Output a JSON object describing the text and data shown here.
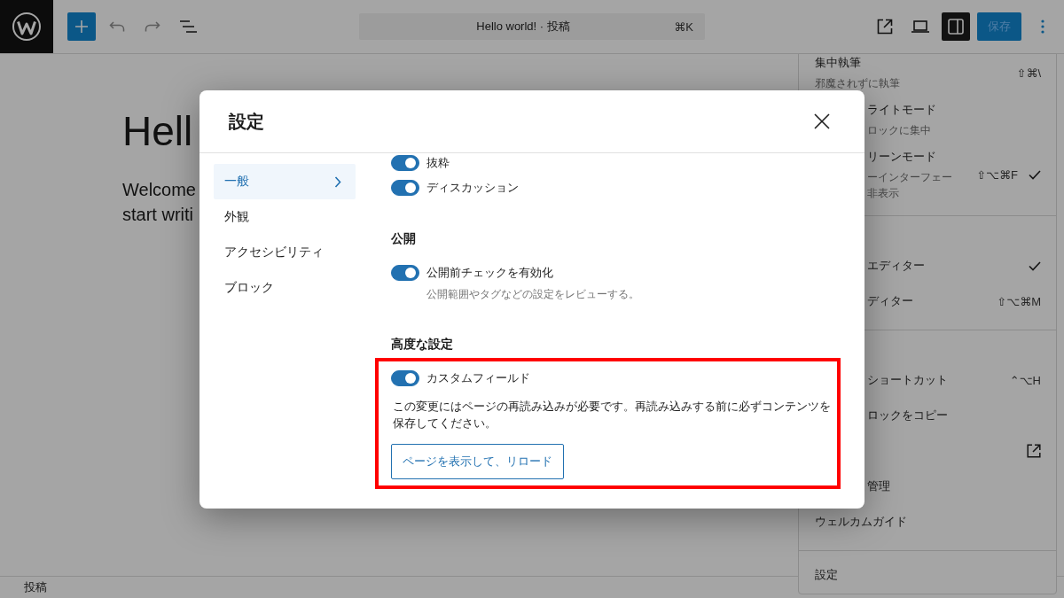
{
  "top_bar": {
    "command_center": {
      "title": "Hello world! · 投稿",
      "shortcut": "⌘K"
    },
    "sidebar_toggle": {
      "pressed": true
    },
    "save_button": {
      "label": "保存",
      "disabled": true
    },
    "menu_button": {
      "pressed": true
    }
  },
  "editor": {
    "title": "Hell",
    "body_lines": [
      "Welcome",
      "start writi"
    ]
  },
  "options_menu": {
    "groups": [
      {
        "items": [
          {
            "label": "集中執筆",
            "description_lines": [
              "邪魔されずに執筆"
            ],
            "shortcut": "⇧⌘\\",
            "checked": false
          },
          {
            "label": "ライトモード",
            "description_lines": [
              "ロックに集中"
            ],
            "checked": false
          },
          {
            "label": "リーンモード",
            "description_lines": [
              "ーインターフェー",
              "非表示"
            ],
            "shortcut": "⇧⌥⌘F",
            "checked": true
          }
        ]
      },
      {
        "items": [
          {
            "label": "エディター",
            "checked": true
          },
          {
            "label": "ディター",
            "shortcut": "⇧⌥⌘M",
            "checked": false
          }
        ]
      },
      {
        "items": [
          {
            "label": "ショートカット",
            "shortcut": "⌃⌥H"
          },
          {
            "label": "ロックをコピー"
          },
          {
            "external": true
          },
          {
            "label": "管理"
          },
          {
            "label": "ウェルカムガイド"
          }
        ]
      },
      {
        "items": [
          {
            "label": "設定"
          }
        ]
      }
    ]
  },
  "settings_modal": {
    "title": "設定",
    "nav": [
      {
        "label": "一般",
        "selected": true
      },
      {
        "label": "外観",
        "selected": false
      },
      {
        "label": "アクセシビリティ",
        "selected": false
      },
      {
        "label": "ブロック",
        "selected": false
      }
    ],
    "sections": [
      {
        "highlighted": false,
        "options": [
          {
            "label": "抜粋",
            "on": true
          },
          {
            "label": "ディスカッション",
            "on": true
          }
        ]
      },
      {
        "title": "公開",
        "highlighted": false,
        "options": [
          {
            "label": "公開前チェックを有効化",
            "on": true,
            "help": "公開範囲やタグなどの設定をレビューする。"
          }
        ]
      },
      {
        "title": "高度な設定",
        "highlighted": true,
        "options": [
          {
            "label": "カスタムフィールド",
            "on": true,
            "note": "この変更にはページの再読み込みが必要です。再読み込みする前に必ずコンテンツを保存してください。",
            "action": "ページを表示して、リロード"
          }
        ]
      }
    ]
  },
  "status_bar": {
    "breadcrumb": "投稿"
  }
}
